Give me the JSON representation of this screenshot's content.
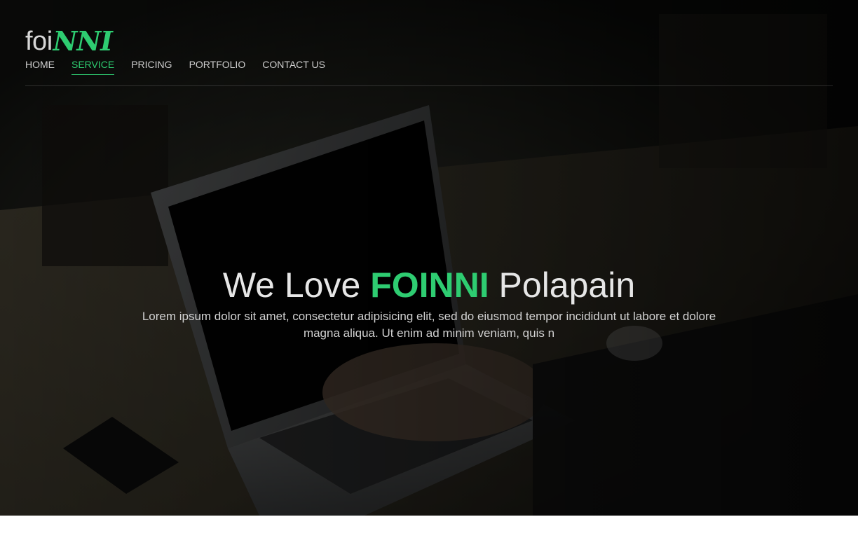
{
  "logo": {
    "part1": "foi",
    "part2": "NNI"
  },
  "nav": {
    "items": [
      {
        "label": "HOME",
        "active": false
      },
      {
        "label": "SERVICE",
        "active": true
      },
      {
        "label": "PRICING",
        "active": false
      },
      {
        "label": "PORTFOLIO",
        "active": false
      },
      {
        "label": "CONTACT US",
        "active": false
      }
    ]
  },
  "hero": {
    "headline_pre": "We Love",
    "headline_brand": "FOINNI",
    "headline_post": "Polapain",
    "subtext": "Lorem ipsum dolor sit amet, consectetur adipisicing elit, sed do eiusmod tempor incididunt ut labore et dolore magna aliqua. Ut enim ad minim veniam, quis n",
    "background": "laptop-desk-photo"
  },
  "colors": {
    "accent": "#2ecc71",
    "nav_text": "#cfcfcf",
    "overlay": "#0b0d0c"
  }
}
